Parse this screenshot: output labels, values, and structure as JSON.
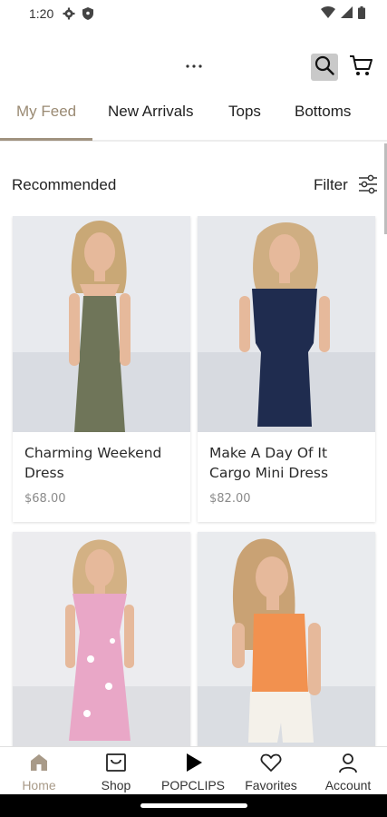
{
  "status": {
    "time": "1:20"
  },
  "tabs": [
    "My Feed",
    "New Arrivals",
    "Tops",
    "Bottoms"
  ],
  "section": {
    "title": "Recommended",
    "filter_label": "Filter"
  },
  "products": [
    {
      "name": "Charming Weekend Dress",
      "price": "$68.00",
      "garment_color": "#6f7559",
      "bg_color": "#e8eaee"
    },
    {
      "name": "Make A Day Of It Cargo Mini Dress",
      "price": "$82.00",
      "garment_color": "#1f2c4f",
      "bg_color": "#e6e8ec"
    },
    {
      "name": "",
      "price": "",
      "garment_color": "#e9a7c7",
      "bg_color": "#ececef"
    },
    {
      "name": "",
      "price": "",
      "garment_color": "#f2914f",
      "bg_color": "#e9ebee"
    }
  ],
  "bottom_nav": [
    {
      "label": "Home",
      "icon": "home-icon",
      "active": true
    },
    {
      "label": "Shop",
      "icon": "shop-icon",
      "active": false
    },
    {
      "label": "POPCLIPS",
      "icon": "play-icon",
      "active": false
    },
    {
      "label": "Favorites",
      "icon": "heart-icon",
      "active": false
    },
    {
      "label": "Account",
      "icon": "account-icon",
      "active": false
    }
  ],
  "colors": {
    "accent": "#a0927f",
    "search_bg": "#c9c9c9"
  }
}
